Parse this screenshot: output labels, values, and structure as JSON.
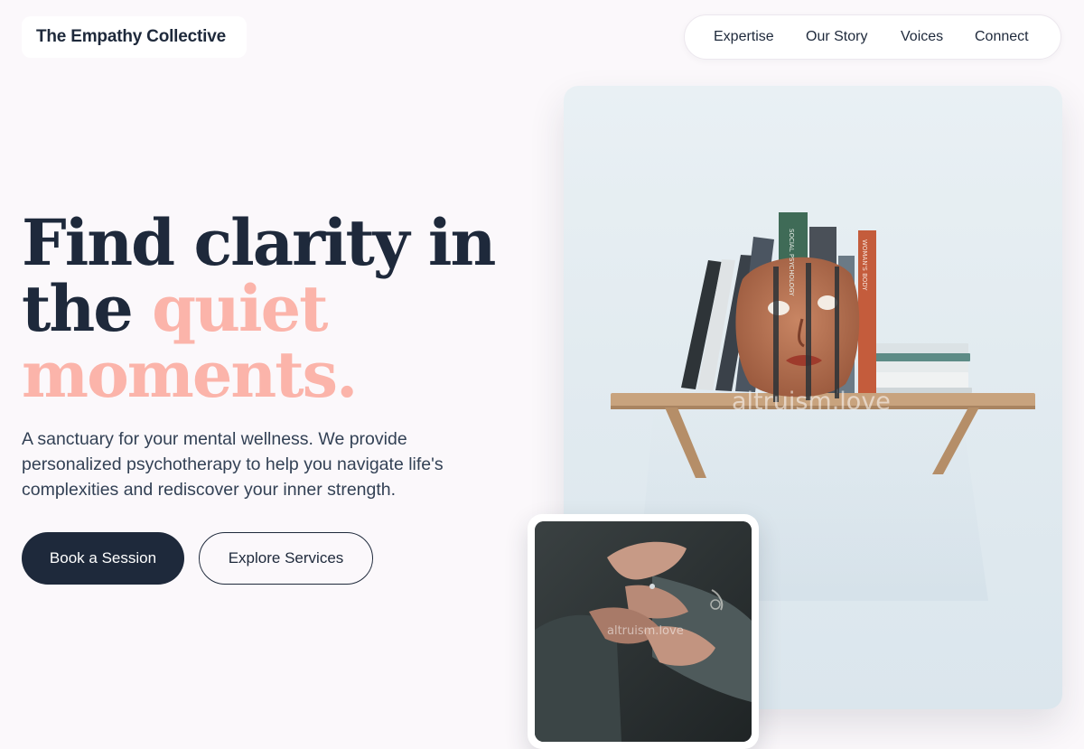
{
  "brand": {
    "name": "The Empathy Collective"
  },
  "nav": {
    "items": [
      "Expertise",
      "Our Story",
      "Voices",
      "Connect"
    ]
  },
  "hero": {
    "headline_line1": "Find clarity in",
    "headline_line2_plain": "the ",
    "headline_line2_accent": "quiet",
    "headline_line3_accent": "moments.",
    "lede": "A sanctuary for your mental wellness. We provide personalized psychotherapy to help you navigate life's complexities and rediscover your inner strength.",
    "primary_cta": "Book a Session",
    "secondary_cta": "Explore Services"
  },
  "images": {
    "main": {
      "watermark": "altruism.love",
      "spines": [
        "SOCIAL PSYCHOLOGY",
        "WOMAN'S BODY"
      ]
    },
    "inset": {
      "watermark": "altruism.love"
    }
  },
  "colors": {
    "background": "#fbf8fb",
    "navy": "#1e293b",
    "accent": "#fbb4aa",
    "text_muted": "#334155"
  }
}
